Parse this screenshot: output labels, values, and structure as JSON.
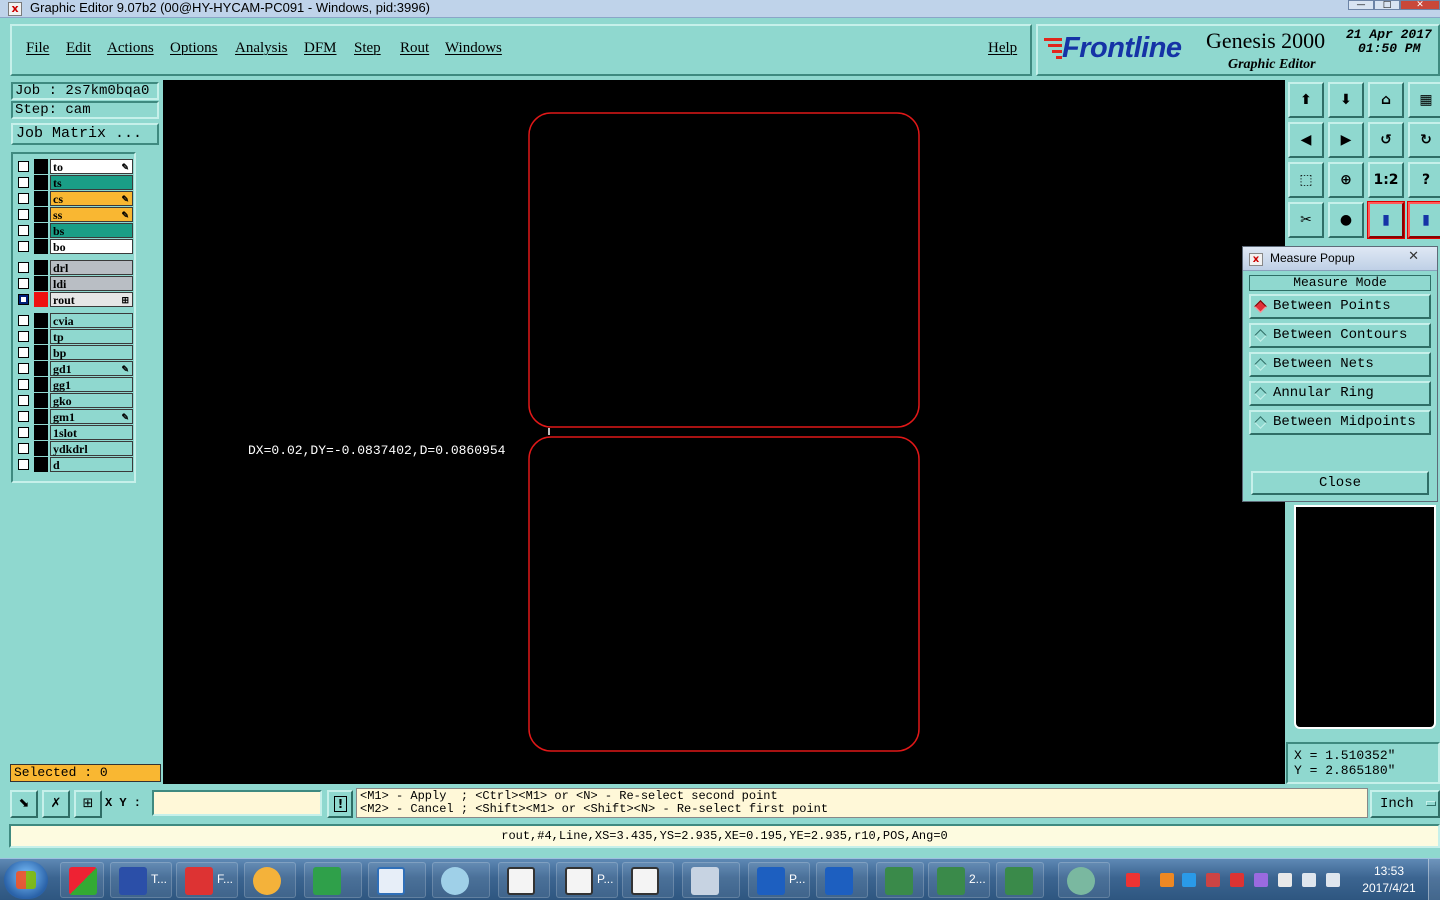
{
  "window": {
    "title": "Graphic Editor 9.07b2 (00@HY-HYCAM-PC091 - Windows, pid:3996)",
    "buttons": [
      "—",
      "□",
      "✕"
    ]
  },
  "menu": {
    "items": [
      "File",
      "Edit",
      "Actions",
      "Options",
      "Analysis",
      "DFM",
      "Step",
      "Rout",
      "Windows"
    ],
    "help": "Help"
  },
  "logo": {
    "brand": "Frontline",
    "product": "Genesis 2000",
    "subtitle": "Graphic Editor",
    "date_line1": "21 Apr 2017",
    "date_line2": "01:50 PM"
  },
  "job": {
    "job_label": "Job : 2s7km0bqa0",
    "step_label": "Step: cam",
    "matrix_button": "Job Matrix ..."
  },
  "layers": [
    {
      "name": "to",
      "color": "#ffffff",
      "flag": "✎",
      "checked": false
    },
    {
      "name": "ts",
      "color": "#1a9e86",
      "flag": "",
      "checked": false
    },
    {
      "name": "cs",
      "color": "#f9b732",
      "flag": "✎",
      "checked": false
    },
    {
      "name": "ss",
      "color": "#f9b732",
      "flag": "✎",
      "checked": false
    },
    {
      "name": "bs",
      "color": "#1a9e86",
      "flag": "",
      "checked": false
    },
    {
      "name": "bo",
      "color": "#ffffff",
      "flag": "",
      "checked": false
    },
    {
      "name": "drl",
      "color": "#b9bec4",
      "flag": "",
      "checked": false
    },
    {
      "name": "ldi",
      "color": "#b9bec4",
      "flag": "",
      "checked": false
    },
    {
      "name": "rout",
      "color": "#e6e6e6",
      "flag": "⊞",
      "checked": true,
      "active": true
    },
    {
      "name": "cvia",
      "color": "#8fd8cf",
      "flag": "",
      "checked": false
    },
    {
      "name": "tp",
      "color": "#8fd8cf",
      "flag": "",
      "checked": false
    },
    {
      "name": "bp",
      "color": "#8fd8cf",
      "flag": "",
      "checked": false
    },
    {
      "name": "gd1",
      "color": "#8fd8cf",
      "flag": "✎",
      "checked": false
    },
    {
      "name": "gg1",
      "color": "#8fd8cf",
      "flag": "",
      "checked": false
    },
    {
      "name": "gko",
      "color": "#8fd8cf",
      "flag": "",
      "checked": false
    },
    {
      "name": "gm1",
      "color": "#8fd8cf",
      "flag": "✎",
      "checked": false
    },
    {
      "name": "1slot",
      "color": "#8fd8cf",
      "flag": "",
      "checked": false
    },
    {
      "name": "ydkdrl",
      "color": "#8fd8cf",
      "flag": "",
      "checked": false
    },
    {
      "name": "d",
      "color": "#8fd8cf",
      "flag": "",
      "checked": false
    }
  ],
  "selected": "Selected : 0",
  "canvas": {
    "measure_text": "DX=0.02,DY=-0.0837402,D=0.0860954",
    "outline_color": "#e01818"
  },
  "toolbar_icons": [
    "zoom-home-icon",
    "zoom-in-icon",
    "home-icon",
    "grid-icon",
    "pan-left-icon",
    "pan-right-icon",
    "undo-zoom-icon",
    "redo-zoom-icon",
    "zoom-fit-icon",
    "zoom-center-icon",
    "one-to-two-icon",
    "help-icon",
    "ruler-icon",
    "measure-icon",
    "traffic-light-icon",
    "traffic-light-icon"
  ],
  "tool_glyphs": [
    "⬆",
    "⬇",
    "⌂",
    "▦",
    "◀",
    "▶",
    "↺",
    "↻",
    "⬚",
    "⊕",
    "1:2",
    "?",
    "✂",
    "●",
    "▮",
    "▮"
  ],
  "measure_popup": {
    "title": "Measure Popup",
    "mode_label": "Measure Mode",
    "options": [
      "Between Points",
      "Between Contours",
      "Between Nets",
      "Annular Ring",
      "Between Midpoints"
    ],
    "selected_index": 0,
    "close": "Close"
  },
  "coords": {
    "x": "X = 1.510352\"",
    "y": "Y = 2.865180\""
  },
  "bottom": {
    "xy_label": "X Y :",
    "xy_value": "",
    "hint_line1": "<M1> - Apply  ; <Ctrl><M1> or <N> - Re-select second point",
    "hint_line2": "<M2> - Cancel ; <Shift><M1> or <Shift><N> - Re-select first point",
    "unit": "Inch",
    "status": "rout,#4,Line,XS=3.435,YS=2.935,XE=0.195,YE=2.935,r10,POS,Ang=0"
  },
  "taskbar": {
    "labels": [
      "T...",
      "F...",
      "P...",
      "P...",
      "2..."
    ],
    "time": "13:53",
    "date": "2017/4/21"
  }
}
